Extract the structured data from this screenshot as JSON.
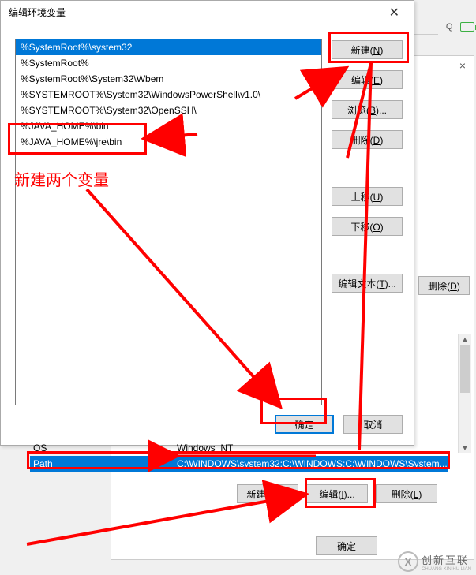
{
  "dialog": {
    "title": "编辑环境变量",
    "list_items": [
      "%SystemRoot%\\system32",
      "%SystemRoot%",
      "%SystemRoot%\\System32\\Wbem",
      "%SYSTEMROOT%\\System32\\WindowsPowerShell\\v1.0\\",
      "%SYSTEMROOT%\\System32\\OpenSSH\\",
      "%JAVA_HOME%\\bin",
      "%JAVA_HOME%\\jre\\bin"
    ],
    "buttons": {
      "new": "新建(N)",
      "edit": "编辑(E)",
      "browse": "浏览(B)...",
      "delete": "删除(D)",
      "move_up": "上移(U)",
      "move_down": "下移(O)",
      "edit_text": "编辑文本(T)..."
    },
    "footer": {
      "ok": "确定",
      "cancel": "取消"
    }
  },
  "bg": {
    "close": "×",
    "row1": {
      "name": "OS",
      "value": "Windows_NT"
    },
    "row2": {
      "name": "Path",
      "value": "C:\\WINDOWS\\system32;C:\\WINDOWS;C:\\WINDOWS\\System..."
    },
    "buttons": {
      "new": "新建(W)...",
      "edit": "编辑(I)...",
      "delete": "删除(L)"
    },
    "footer_ok": "确定",
    "ext_delete": "删除(D)"
  },
  "search_placeholder": "搜",
  "annotation": {
    "text": "新建两个变量"
  },
  "logo": {
    "mark": "X",
    "line1": "创新互联",
    "line2": "CHUANG XIN HU LIAN"
  }
}
